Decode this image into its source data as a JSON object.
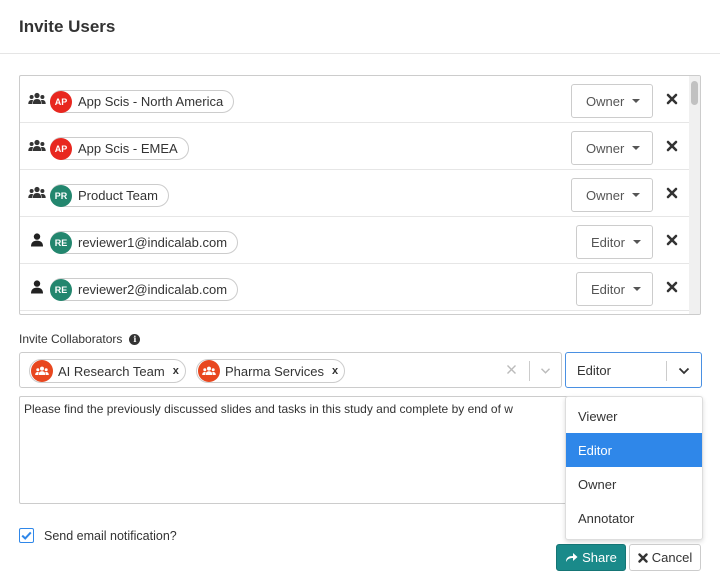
{
  "dialog": {
    "title": "Invite Users"
  },
  "members": [
    {
      "type": "group",
      "avatar_text": "AP",
      "avatar_color": "#e8271f",
      "name": "App Scis - North America",
      "role": "Owner"
    },
    {
      "type": "group",
      "avatar_text": "AP",
      "avatar_color": "#e8271f",
      "name": "App Scis - EMEA",
      "role": "Owner"
    },
    {
      "type": "group",
      "avatar_text": "PR",
      "avatar_color": "#23866e",
      "name": "Product Team",
      "role": "Owner"
    },
    {
      "type": "user",
      "avatar_text": "RE",
      "avatar_color": "#23866e",
      "name": "reviewer1@indicalab.com",
      "role": "Editor"
    },
    {
      "type": "user",
      "avatar_text": "RE",
      "avatar_color": "#23866e",
      "name": "reviewer2@indicalab.com",
      "role": "Editor"
    }
  ],
  "invite": {
    "label": "Invite Collaborators",
    "info_icon": "i",
    "selected": [
      {
        "name": "AI Research Team",
        "remove": "x"
      },
      {
        "name": "Pharma Services",
        "remove": "x"
      }
    ],
    "role_value": "Editor",
    "message": "Please find the previously discussed slides and tasks in this study and complete by end of w",
    "role_options": [
      "Viewer",
      "Editor",
      "Owner",
      "Annotator"
    ],
    "active_option": "Editor"
  },
  "notify": {
    "label": "Send email notification?",
    "checked": true
  },
  "actions": {
    "share_label": "Share",
    "cancel_label": "Cancel"
  },
  "icons": {
    "group": "users-icon",
    "user": "user-icon",
    "remove": "close-icon",
    "share": "share-icon",
    "cancel": "close-icon"
  },
  "colors": {
    "accent": "#2f87e9",
    "share_button": "#1a8a8a",
    "group_tag": "#e8471f"
  }
}
